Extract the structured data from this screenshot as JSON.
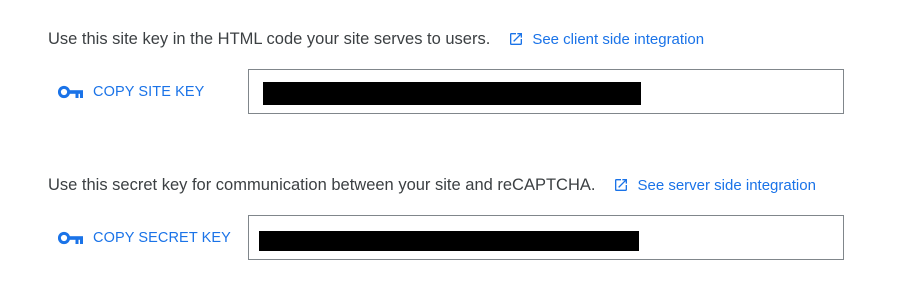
{
  "colors": {
    "link": "#1a73e8",
    "text": "#3c4043",
    "field_border": "#80868b",
    "redaction": "#000000"
  },
  "site_key": {
    "description": "Use this site key in the HTML code your site serves to users.",
    "link_label": "See client side integration",
    "link_icon": "open-in-new-icon",
    "copy_label": "COPY SITE KEY",
    "copy_icon": "key-icon",
    "value": ""
  },
  "secret_key": {
    "description": "Use this secret key for communication between your site and reCAPTCHA.",
    "link_label": "See server side integration",
    "link_icon": "open-in-new-icon",
    "copy_label": "COPY SECRET KEY",
    "copy_icon": "key-icon",
    "value": ""
  }
}
